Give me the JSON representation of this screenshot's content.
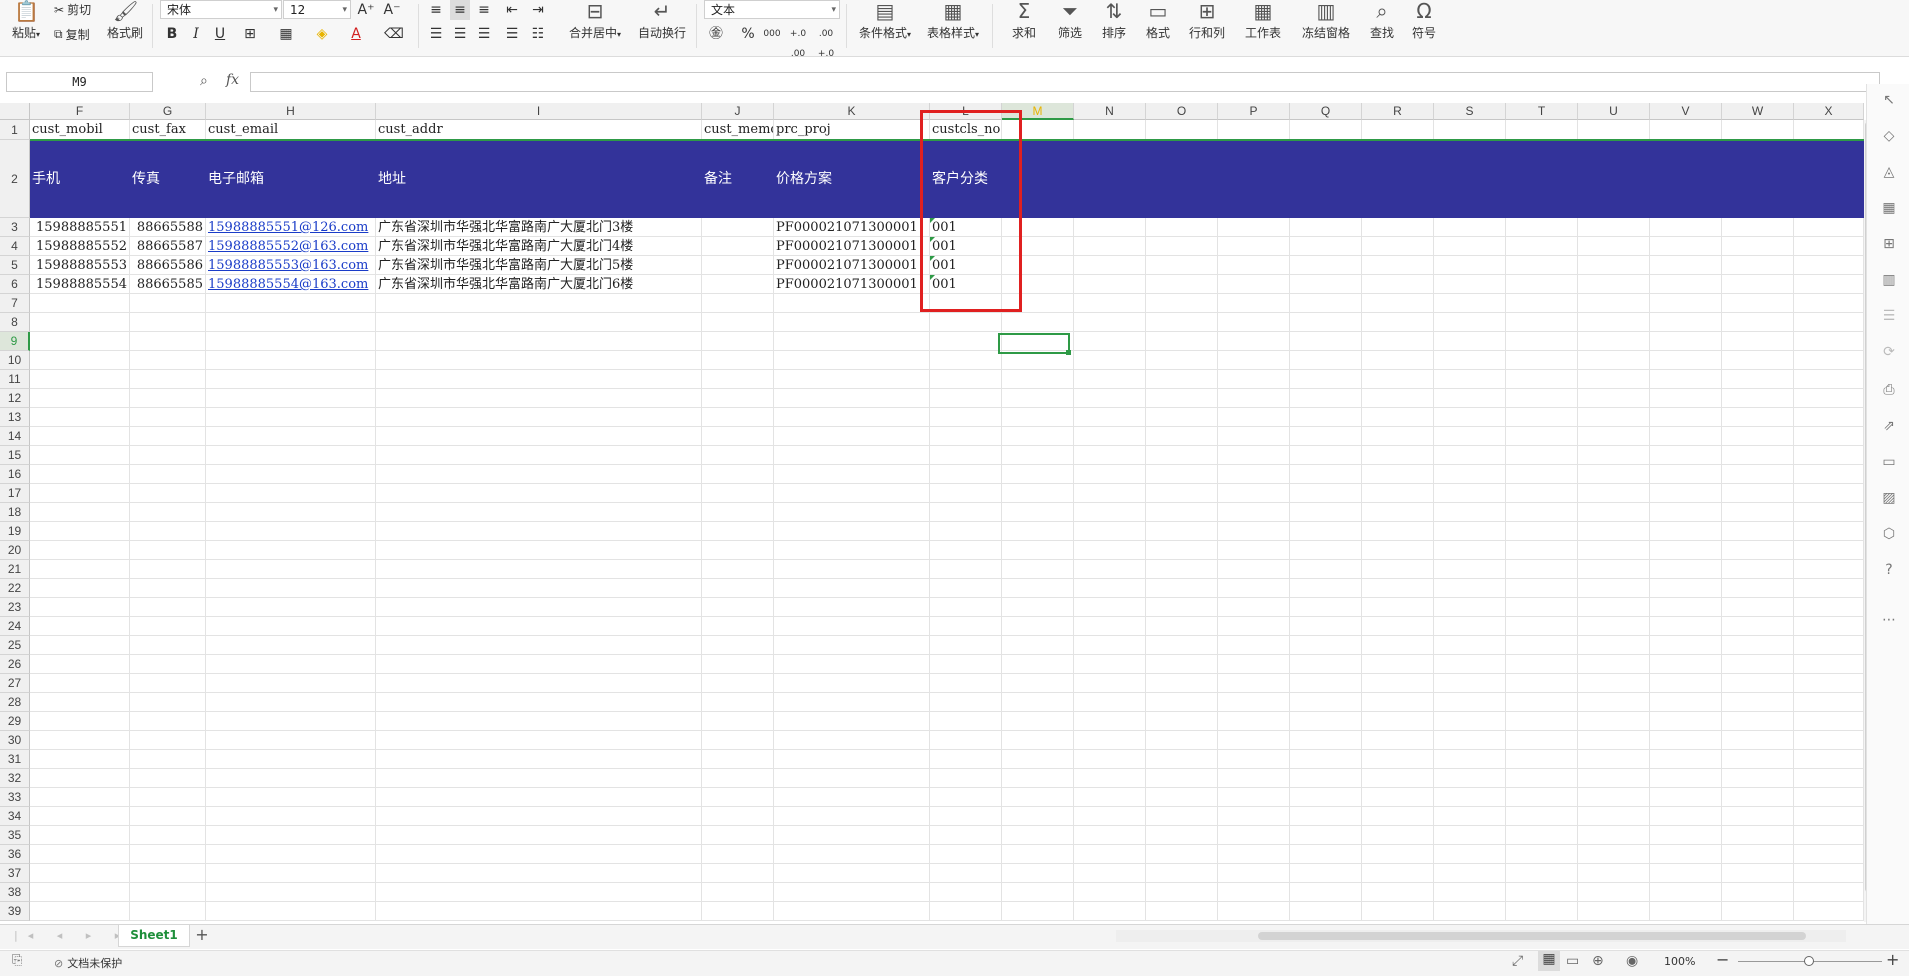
{
  "ribbon": {
    "paste": "粘贴",
    "cut": "剪切",
    "copy": "复制",
    "format_painter": "格式刷",
    "font_name": "宋体",
    "font_size": "12",
    "merge_center": "合并居中",
    "wrap_text": "自动换行",
    "number_format": "文本",
    "cond_format": "条件格式",
    "table_style": "表格样式",
    "sum": "求和",
    "filter": "筛选",
    "sort": "排序",
    "format": "格式",
    "row_col": "行和列",
    "worksheet": "工作表",
    "freeze": "冻结窗格",
    "find": "查找",
    "symbol": "符号",
    "bold": "B",
    "italic": "I",
    "underline": "U",
    "percent": "%",
    "thousands": "000",
    "inc_dec": "+.0 .00",
    "dec_dec": ".00 +.0",
    "font_grow": "A⁺",
    "font_shrink": "A⁻",
    "font_color": "A"
  },
  "formula_bar": {
    "name_box": "M9",
    "fx": "fx",
    "value": ""
  },
  "columns": [
    "F",
    "G",
    "H",
    "I",
    "J",
    "K",
    "L",
    "M",
    "N",
    "O",
    "P",
    "Q",
    "R",
    "S",
    "T",
    "U",
    "V",
    "W",
    "X"
  ],
  "rows": [
    "1",
    "2",
    "3",
    "4",
    "5",
    "6",
    "7",
    "8",
    "9",
    "10",
    "11",
    "12",
    "13",
    "14",
    "15",
    "16",
    "17",
    "18",
    "19",
    "20",
    "21",
    "22",
    "23",
    "24",
    "25",
    "26",
    "27",
    "28",
    "29",
    "30",
    "31",
    "32",
    "33",
    "34",
    "35",
    "36",
    "37",
    "38",
    "39"
  ],
  "sheet": {
    "row1": [
      "cust_mobil",
      "cust_fax",
      "cust_email",
      "cust_addr",
      "cust_memo",
      "prc_proj",
      "custcls_no"
    ],
    "row2": [
      "手机",
      "传真",
      "电子邮箱",
      "地址",
      "备注",
      "价格方案",
      "客户分类"
    ],
    "data": [
      [
        "15988885551",
        "88665588",
        "15988885551@126.com",
        "广东省深圳市华强北华富路南广大厦北门3楼",
        "",
        "PF000021071300001",
        "001"
      ],
      [
        "15988885552",
        "88665587",
        "15988885552@163.com",
        "广东省深圳市华强北华富路南广大厦北门4楼",
        "",
        "PF000021071300001",
        "001"
      ],
      [
        "15988885553",
        "88665586",
        "15988885553@163.com",
        "广东省深圳市华强北华富路南广大厦北门5楼",
        "",
        "PF000021071300001",
        "001"
      ],
      [
        "15988885554",
        "88665585",
        "15988885554@163.com",
        "广东省深圳市华强北华富路南广大厦北门6楼",
        "",
        "PF000021071300001",
        "001"
      ]
    ]
  },
  "tabs": {
    "sheet1": "Sheet1",
    "add": "+"
  },
  "status": {
    "protect": "文档未保护",
    "zoom": "100%"
  },
  "colors": {
    "header_band": "#33339a",
    "highlight_box": "#e02020",
    "selection": "#2e9a46",
    "sheet_tab": "#1e8f3a"
  },
  "icons": [
    "paste-icon",
    "cut-icon",
    "copy-icon",
    "format-painter-icon",
    "sum-icon",
    "filter-icon",
    "sort-icon",
    "find-icon",
    "symbol-icon",
    "zoom-in-icon",
    "zoom-out-icon"
  ]
}
